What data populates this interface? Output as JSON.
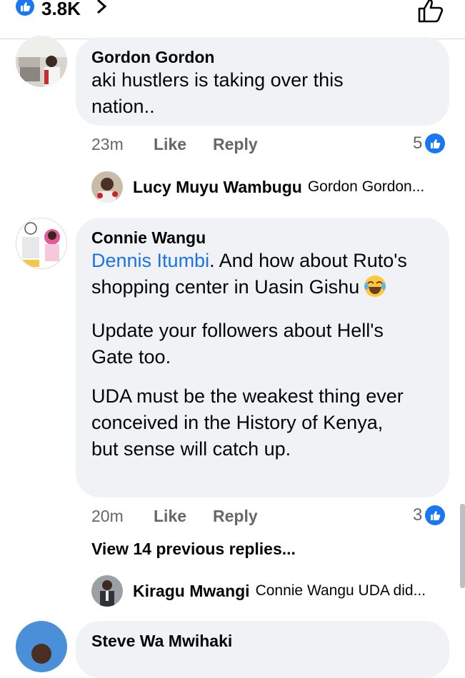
{
  "header": {
    "like_count": "3.8K"
  },
  "comments": [
    {
      "author": "Gordon Gordon",
      "text": "aki hustlers is taking over this\nnation..",
      "time": "23m",
      "like_label": "Like",
      "reply_label": "Reply",
      "reactions": "5",
      "reply": {
        "name": "Lucy Muyu Wambugu",
        "text": "Gordon Gordon..."
      }
    },
    {
      "author": "Connie Wangu",
      "mention": "Dennis Itumbi",
      "text_after_mention": ". And how about Ruto's\nshopping center in Uasin Gishu",
      "text_p2": "Update your followers about Hell's\nGate too.",
      "text_p3": "UDA must be the weakest thing ever\nconceived in the History of Kenya,\nbut sense will catch up.",
      "time": "20m",
      "like_label": "Like",
      "reply_label": "Reply",
      "reactions": "3",
      "view_more": "View 14 previous replies...",
      "reply": {
        "name": "Kiragu Mwangi",
        "text": "Connie Wangu UDA did..."
      }
    },
    {
      "author": "Steve Wa Mwihaki"
    }
  ],
  "colors": {
    "accent": "#1877f2",
    "bubble": "#f0f2f5",
    "meta": "#65676b",
    "mention": "#1b74e4"
  },
  "icons": [
    "like-icon",
    "chevron-right-icon",
    "thumbs-up-outline-icon",
    "laughing-emoji-icon"
  ]
}
